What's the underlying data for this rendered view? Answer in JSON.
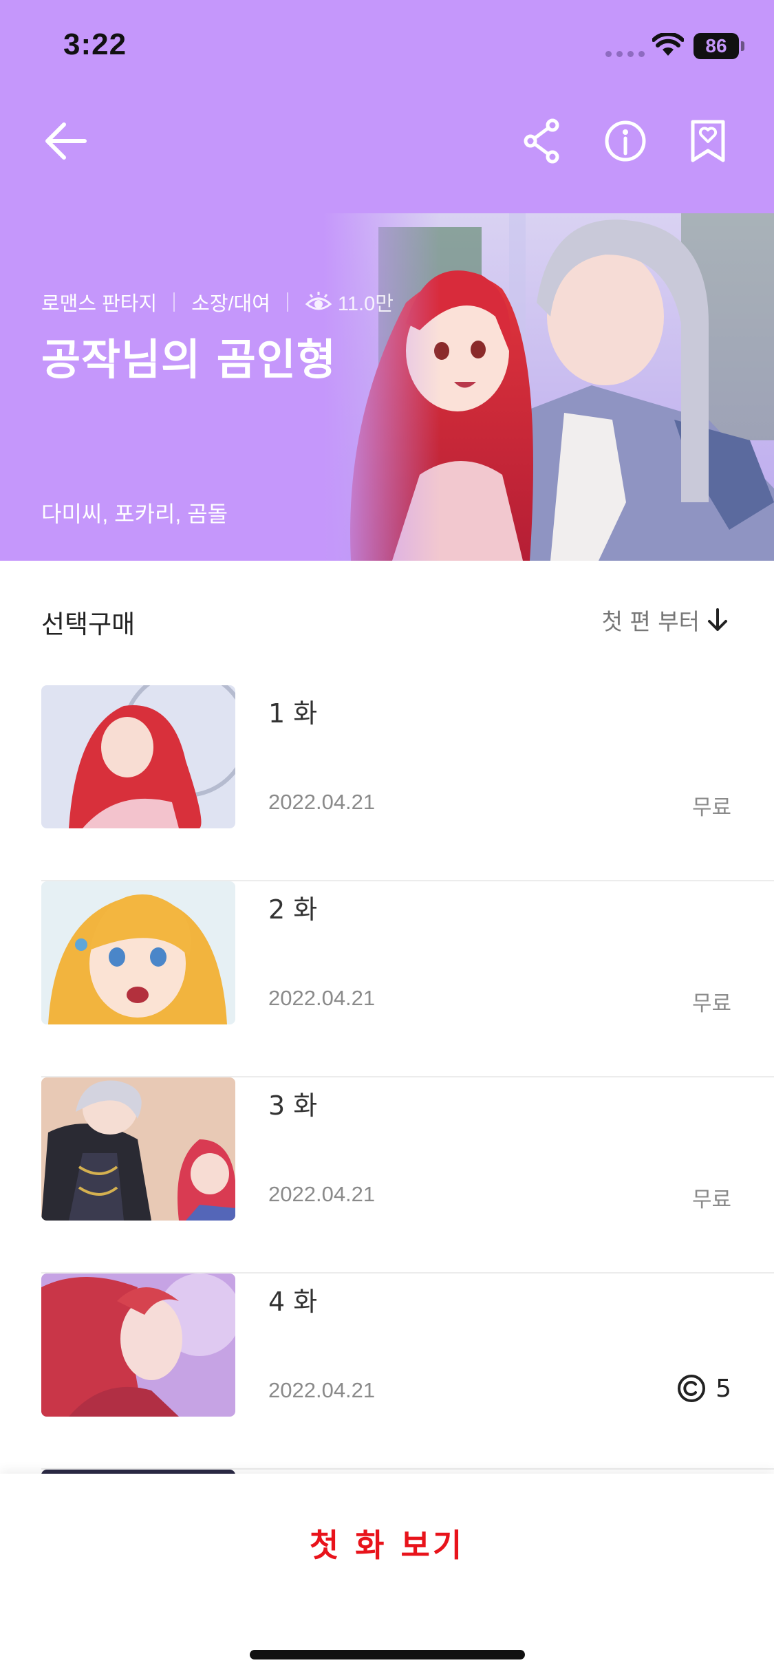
{
  "status_bar": {
    "time": "3:22",
    "battery": "86"
  },
  "hero": {
    "background_color": "#c597fb",
    "genre": "로맨스 판타지",
    "purchase_type": "소장/대여",
    "views": "11.0만",
    "title": "공작님의 곰인형",
    "authors": "다미씨, 포카리, 곰돌",
    "icons": [
      "back-arrow-icon",
      "share-icon",
      "info-icon",
      "bookmark-heart-icon",
      "eye-icon"
    ]
  },
  "list": {
    "header_title": "선택구매",
    "sort_label": "첫 편 부터",
    "episodes": [
      {
        "title": "1 화",
        "date": "2022.04.21",
        "price": "무료"
      },
      {
        "title": "2 화",
        "date": "2022.04.21",
        "price": "무료"
      },
      {
        "title": "3 화",
        "date": "2022.04.21",
        "price": "무료"
      },
      {
        "title": "4 화",
        "date": "2022.04.21",
        "coin": "5"
      }
    ]
  },
  "bottom": {
    "cta_label": "첫 화 보기",
    "cta_color": "#e8131b"
  }
}
